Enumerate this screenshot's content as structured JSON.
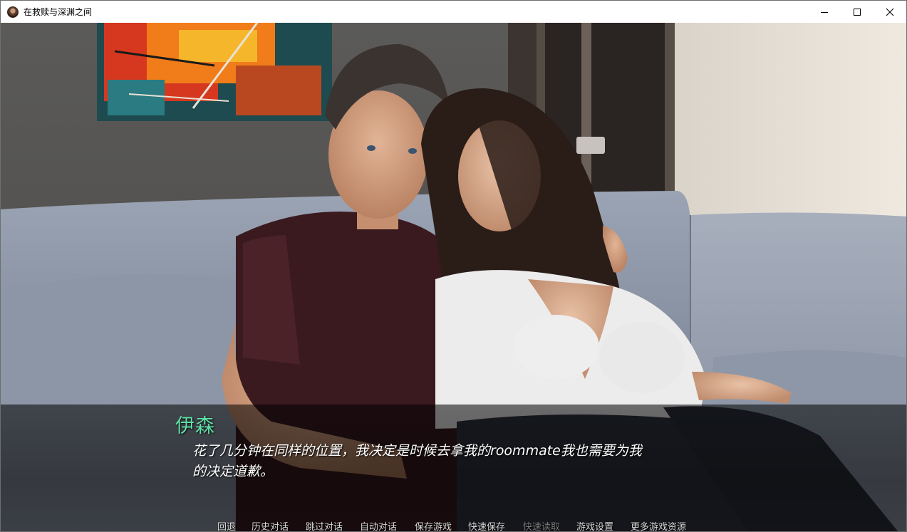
{
  "window": {
    "title": "在救赎与深渊之间",
    "icon": "game-avatar-icon",
    "controls": [
      "minimize-icon",
      "maximize-icon",
      "close-icon"
    ]
  },
  "dialogue": {
    "speaker": "伊森",
    "speaker_color": "#5fe0a6",
    "line1": "花了几分钟在同样的位置，我决定是时候去拿我的roommate我也需要为我",
    "line2": "的决定道歉。"
  },
  "quick_menu": {
    "back": "回退",
    "history": "历史对话",
    "skip": "跳过对话",
    "auto": "自动对话",
    "save": "保存游戏",
    "quick_save": "快速保存",
    "quick_load": "快速读取",
    "settings": "游戏设置",
    "more": "更多游戏资源"
  }
}
